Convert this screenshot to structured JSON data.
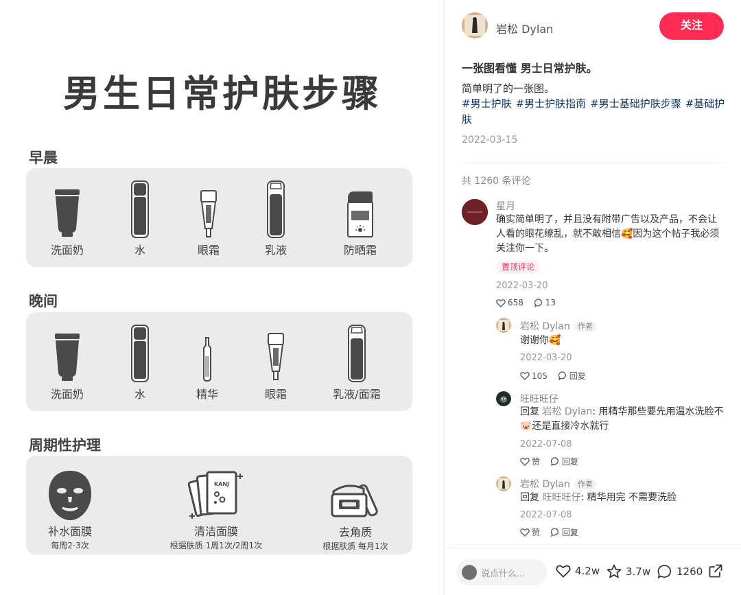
{
  "poster": {
    "title": "男生日常护肤步骤",
    "morning": {
      "title": "早晨",
      "items": [
        {
          "label": "洗面奶",
          "icon": "tube-icon"
        },
        {
          "label": "水",
          "icon": "toner-bottle-icon"
        },
        {
          "label": "眼霜",
          "icon": "eye-cream-icon"
        },
        {
          "label": "乳液",
          "icon": "lotion-bottle-icon"
        },
        {
          "label": "防晒霜",
          "icon": "sunscreen-icon"
        }
      ]
    },
    "night": {
      "title": "晚间",
      "items": [
        {
          "label": "洗面奶",
          "icon": "tube-icon"
        },
        {
          "label": "水",
          "icon": "toner-bottle-icon"
        },
        {
          "label": "精华",
          "icon": "ampoule-icon"
        },
        {
          "label": "眼霜",
          "icon": "eye-cream-icon"
        },
        {
          "label": "乳液/面霜",
          "icon": "lotion-bottle-icon"
        }
      ]
    },
    "periodic": {
      "title": "周期性护理",
      "items": [
        {
          "label": "补水面膜",
          "sub": "每周2-3次",
          "icon": "sheet-mask-icon"
        },
        {
          "label": "清洁面膜",
          "sub": "根据肤质 1周1次/2周1次",
          "icon": "clay-mask-packets-icon"
        },
        {
          "label": "去角质",
          "sub": "根据肤质 每月1次",
          "icon": "exfoliant-jar-icon"
        }
      ],
      "packet_text": "KANJ"
    }
  },
  "note": {
    "author": "岩松 Dylan",
    "follow_label": "关注",
    "title": "一张图看懂 男士日常护肤。",
    "desc": "简单明了的一张图。",
    "tags": [
      "#男士护肤",
      "#男士护肤指南",
      "#男士基础护肤步骤",
      "#基础护肤"
    ],
    "date": "2022-03-15",
    "comment_count": "共 1260 条评论"
  },
  "comments": [
    {
      "name": "星月",
      "text": "确实简单明了，并且没有附带广告以及产品，不会让人看的眼花缭乱，就不敢相信🥰因为这个帖子我必须关注你一下。",
      "pin": "置顶评论",
      "date": "2022-03-20",
      "likes": "658",
      "replies": "13"
    },
    {
      "name": "岩松 Dylan",
      "badge": "作者",
      "text": "谢谢你🥰",
      "date": "2022-03-20",
      "likes": "105",
      "reply_label": "回复"
    },
    {
      "name": "旺旺旺仔",
      "text_prefix": "回复",
      "text_ref": "岩松 Dylan",
      "text": ": 用精华那些要先用温水洗脸不🐷还是直接冷水就行",
      "date": "2022-07-08",
      "likes": "赞",
      "reply_label": "回复"
    },
    {
      "name": "岩松 Dylan",
      "badge": "作者",
      "text_prefix": "回复",
      "text_ref": "旺旺旺仔",
      "text": ": 精华用完 不需要洗脸",
      "date": "2022-07-08",
      "likes": "赞",
      "reply_label": "回复"
    }
  ],
  "bottom_bar": {
    "placeholder": "说点什么...",
    "likes": "4.2w",
    "collects": "3.7w",
    "comments": "1260"
  },
  "colors": {
    "accent": "#fe2c55",
    "tag": "#13386c",
    "panel": "#ebebeb",
    "icon_dark": "#4a4a4a"
  }
}
